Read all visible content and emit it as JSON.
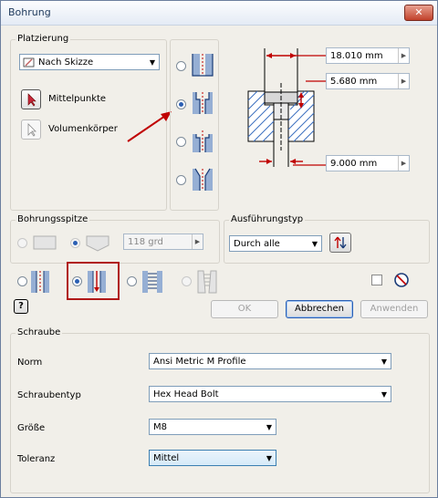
{
  "window": {
    "title": "Bohrung",
    "close_glyph": "✕"
  },
  "placement": {
    "group_label": "Platzierung",
    "type_value": "Nach Skizze",
    "centers_label": "Mittelpunkte",
    "solids_label": "Volumenkörper"
  },
  "dimensions": {
    "d1": "18.010 mm",
    "d2": "5.680 mm",
    "d3": "9.000 mm"
  },
  "drill_point": {
    "group_label": "Bohrungsspitze",
    "angle": "118 grd"
  },
  "termination": {
    "group_label": "Ausführungstyp",
    "value": "Durch alle"
  },
  "buttons": {
    "ok": "OK",
    "cancel": "Abbrechen",
    "apply": "Anwenden",
    "help": "?"
  },
  "screw": {
    "group_label": "Schraube",
    "norm_label": "Norm",
    "norm_value": "Ansi Metric M Profile",
    "type_label": "Schraubentyp",
    "type_value": "Hex Head Bolt",
    "size_label": "Größe",
    "size_value": "M8",
    "fit_label": "Toleranz",
    "fit_value": "Mittel"
  },
  "colors": {
    "accent": "#c00000",
    "hatch": "#3b6fc0",
    "focus": "#2b5fb3"
  }
}
